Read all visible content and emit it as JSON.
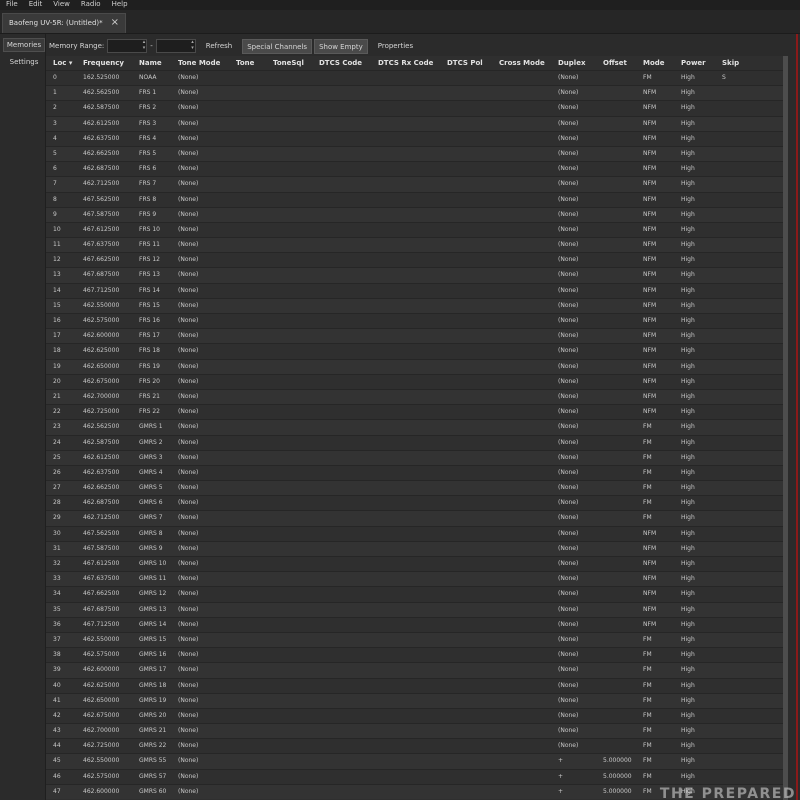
{
  "menu": [
    "File",
    "Edit",
    "View",
    "Radio",
    "Help"
  ],
  "file_tab": {
    "label": "Baofeng UV-5R: (Untitled)*",
    "close": "×"
  },
  "side_tabs": {
    "memories": "Memories",
    "settings": "Settings"
  },
  "toolbar": {
    "memory_range_label": "Memory Range:",
    "range_dash": "-",
    "refresh": "Refresh",
    "special_channels": "Special Channels",
    "show_empty": "Show Empty",
    "properties": "Properties"
  },
  "columns": [
    "Loc ▾",
    "Frequency",
    "Name",
    "Tone Mode",
    "Tone",
    "ToneSql",
    "DTCS Code",
    "DTCS Rx Code",
    "DTCS Pol",
    "Cross Mode",
    "Duplex",
    "Offset",
    "Mode",
    "Power",
    "Skip"
  ],
  "rows": [
    {
      "loc": "0",
      "freq": "162.525000",
      "name": "NOAA",
      "tmode": "(None)",
      "duplex": "(None)",
      "offset": "",
      "mode": "FM",
      "power": "High",
      "skip": "S"
    },
    {
      "loc": "1",
      "freq": "462.562500",
      "name": "FRS 1",
      "tmode": "(None)",
      "duplex": "(None)",
      "offset": "",
      "mode": "NFM",
      "power": "High",
      "skip": ""
    },
    {
      "loc": "2",
      "freq": "462.587500",
      "name": "FRS 2",
      "tmode": "(None)",
      "duplex": "(None)",
      "offset": "",
      "mode": "NFM",
      "power": "High",
      "skip": ""
    },
    {
      "loc": "3",
      "freq": "462.612500",
      "name": "FRS 3",
      "tmode": "(None)",
      "duplex": "(None)",
      "offset": "",
      "mode": "NFM",
      "power": "High",
      "skip": ""
    },
    {
      "loc": "4",
      "freq": "462.637500",
      "name": "FRS 4",
      "tmode": "(None)",
      "duplex": "(None)",
      "offset": "",
      "mode": "NFM",
      "power": "High",
      "skip": ""
    },
    {
      "loc": "5",
      "freq": "462.662500",
      "name": "FRS 5",
      "tmode": "(None)",
      "duplex": "(None)",
      "offset": "",
      "mode": "NFM",
      "power": "High",
      "skip": ""
    },
    {
      "loc": "6",
      "freq": "462.687500",
      "name": "FRS 6",
      "tmode": "(None)",
      "duplex": "(None)",
      "offset": "",
      "mode": "NFM",
      "power": "High",
      "skip": ""
    },
    {
      "loc": "7",
      "freq": "462.712500",
      "name": "FRS 7",
      "tmode": "(None)",
      "duplex": "(None)",
      "offset": "",
      "mode": "NFM",
      "power": "High",
      "skip": ""
    },
    {
      "loc": "8",
      "freq": "467.562500",
      "name": "FRS 8",
      "tmode": "(None)",
      "duplex": "(None)",
      "offset": "",
      "mode": "NFM",
      "power": "High",
      "skip": ""
    },
    {
      "loc": "9",
      "freq": "467.587500",
      "name": "FRS 9",
      "tmode": "(None)",
      "duplex": "(None)",
      "offset": "",
      "mode": "NFM",
      "power": "High",
      "skip": ""
    },
    {
      "loc": "10",
      "freq": "467.612500",
      "name": "FRS 10",
      "tmode": "(None)",
      "duplex": "(None)",
      "offset": "",
      "mode": "NFM",
      "power": "High",
      "skip": ""
    },
    {
      "loc": "11",
      "freq": "467.637500",
      "name": "FRS 11",
      "tmode": "(None)",
      "duplex": "(None)",
      "offset": "",
      "mode": "NFM",
      "power": "High",
      "skip": ""
    },
    {
      "loc": "12",
      "freq": "467.662500",
      "name": "FRS 12",
      "tmode": "(None)",
      "duplex": "(None)",
      "offset": "",
      "mode": "NFM",
      "power": "High",
      "skip": ""
    },
    {
      "loc": "13",
      "freq": "467.687500",
      "name": "FRS 13",
      "tmode": "(None)",
      "duplex": "(None)",
      "offset": "",
      "mode": "NFM",
      "power": "High",
      "skip": ""
    },
    {
      "loc": "14",
      "freq": "467.712500",
      "name": "FRS 14",
      "tmode": "(None)",
      "duplex": "(None)",
      "offset": "",
      "mode": "NFM",
      "power": "High",
      "skip": ""
    },
    {
      "loc": "15",
      "freq": "462.550000",
      "name": "FRS 15",
      "tmode": "(None)",
      "duplex": "(None)",
      "offset": "",
      "mode": "NFM",
      "power": "High",
      "skip": ""
    },
    {
      "loc": "16",
      "freq": "462.575000",
      "name": "FRS 16",
      "tmode": "(None)",
      "duplex": "(None)",
      "offset": "",
      "mode": "NFM",
      "power": "High",
      "skip": ""
    },
    {
      "loc": "17",
      "freq": "462.600000",
      "name": "FRS 17",
      "tmode": "(None)",
      "duplex": "(None)",
      "offset": "",
      "mode": "NFM",
      "power": "High",
      "skip": ""
    },
    {
      "loc": "18",
      "freq": "462.625000",
      "name": "FRS 18",
      "tmode": "(None)",
      "duplex": "(None)",
      "offset": "",
      "mode": "NFM",
      "power": "High",
      "skip": ""
    },
    {
      "loc": "19",
      "freq": "462.650000",
      "name": "FRS 19",
      "tmode": "(None)",
      "duplex": "(None)",
      "offset": "",
      "mode": "NFM",
      "power": "High",
      "skip": ""
    },
    {
      "loc": "20",
      "freq": "462.675000",
      "name": "FRS 20",
      "tmode": "(None)",
      "duplex": "(None)",
      "offset": "",
      "mode": "NFM",
      "power": "High",
      "skip": ""
    },
    {
      "loc": "21",
      "freq": "462.700000",
      "name": "FRS 21",
      "tmode": "(None)",
      "duplex": "(None)",
      "offset": "",
      "mode": "NFM",
      "power": "High",
      "skip": ""
    },
    {
      "loc": "22",
      "freq": "462.725000",
      "name": "FRS 22",
      "tmode": "(None)",
      "duplex": "(None)",
      "offset": "",
      "mode": "NFM",
      "power": "High",
      "skip": ""
    },
    {
      "loc": "23",
      "freq": "462.562500",
      "name": "GMRS 1",
      "tmode": "(None)",
      "duplex": "(None)",
      "offset": "",
      "mode": "FM",
      "power": "High",
      "skip": ""
    },
    {
      "loc": "24",
      "freq": "462.587500",
      "name": "GMRS 2",
      "tmode": "(None)",
      "duplex": "(None)",
      "offset": "",
      "mode": "FM",
      "power": "High",
      "skip": ""
    },
    {
      "loc": "25",
      "freq": "462.612500",
      "name": "GMRS 3",
      "tmode": "(None)",
      "duplex": "(None)",
      "offset": "",
      "mode": "FM",
      "power": "High",
      "skip": ""
    },
    {
      "loc": "26",
      "freq": "462.637500",
      "name": "GMRS 4",
      "tmode": "(None)",
      "duplex": "(None)",
      "offset": "",
      "mode": "FM",
      "power": "High",
      "skip": ""
    },
    {
      "loc": "27",
      "freq": "462.662500",
      "name": "GMRS 5",
      "tmode": "(None)",
      "duplex": "(None)",
      "offset": "",
      "mode": "FM",
      "power": "High",
      "skip": ""
    },
    {
      "loc": "28",
      "freq": "462.687500",
      "name": "GMRS 6",
      "tmode": "(None)",
      "duplex": "(None)",
      "offset": "",
      "mode": "FM",
      "power": "High",
      "skip": ""
    },
    {
      "loc": "29",
      "freq": "462.712500",
      "name": "GMRS 7",
      "tmode": "(None)",
      "duplex": "(None)",
      "offset": "",
      "mode": "FM",
      "power": "High",
      "skip": ""
    },
    {
      "loc": "30",
      "freq": "467.562500",
      "name": "GMRS 8",
      "tmode": "(None)",
      "duplex": "(None)",
      "offset": "",
      "mode": "NFM",
      "power": "High",
      "skip": ""
    },
    {
      "loc": "31",
      "freq": "467.587500",
      "name": "GMRS 9",
      "tmode": "(None)",
      "duplex": "(None)",
      "offset": "",
      "mode": "NFM",
      "power": "High",
      "skip": ""
    },
    {
      "loc": "32",
      "freq": "467.612500",
      "name": "GMRS 10",
      "tmode": "(None)",
      "duplex": "(None)",
      "offset": "",
      "mode": "NFM",
      "power": "High",
      "skip": ""
    },
    {
      "loc": "33",
      "freq": "467.637500",
      "name": "GMRS 11",
      "tmode": "(None)",
      "duplex": "(None)",
      "offset": "",
      "mode": "NFM",
      "power": "High",
      "skip": ""
    },
    {
      "loc": "34",
      "freq": "467.662500",
      "name": "GMRS 12",
      "tmode": "(None)",
      "duplex": "(None)",
      "offset": "",
      "mode": "NFM",
      "power": "High",
      "skip": ""
    },
    {
      "loc": "35",
      "freq": "467.687500",
      "name": "GMRS 13",
      "tmode": "(None)",
      "duplex": "(None)",
      "offset": "",
      "mode": "NFM",
      "power": "High",
      "skip": ""
    },
    {
      "loc": "36",
      "freq": "467.712500",
      "name": "GMRS 14",
      "tmode": "(None)",
      "duplex": "(None)",
      "offset": "",
      "mode": "NFM",
      "power": "High",
      "skip": ""
    },
    {
      "loc": "37",
      "freq": "462.550000",
      "name": "GMRS 15",
      "tmode": "(None)",
      "duplex": "(None)",
      "offset": "",
      "mode": "FM",
      "power": "High",
      "skip": ""
    },
    {
      "loc": "38",
      "freq": "462.575000",
      "name": "GMRS 16",
      "tmode": "(None)",
      "duplex": "(None)",
      "offset": "",
      "mode": "FM",
      "power": "High",
      "skip": ""
    },
    {
      "loc": "39",
      "freq": "462.600000",
      "name": "GMRS 17",
      "tmode": "(None)",
      "duplex": "(None)",
      "offset": "",
      "mode": "FM",
      "power": "High",
      "skip": ""
    },
    {
      "loc": "40",
      "freq": "462.625000",
      "name": "GMRS 18",
      "tmode": "(None)",
      "duplex": "(None)",
      "offset": "",
      "mode": "FM",
      "power": "High",
      "skip": ""
    },
    {
      "loc": "41",
      "freq": "462.650000",
      "name": "GMRS 19",
      "tmode": "(None)",
      "duplex": "(None)",
      "offset": "",
      "mode": "FM",
      "power": "High",
      "skip": ""
    },
    {
      "loc": "42",
      "freq": "462.675000",
      "name": "GMRS 20",
      "tmode": "(None)",
      "duplex": "(None)",
      "offset": "",
      "mode": "FM",
      "power": "High",
      "skip": ""
    },
    {
      "loc": "43",
      "freq": "462.700000",
      "name": "GMRS 21",
      "tmode": "(None)",
      "duplex": "(None)",
      "offset": "",
      "mode": "FM",
      "power": "High",
      "skip": ""
    },
    {
      "loc": "44",
      "freq": "462.725000",
      "name": "GMRS 22",
      "tmode": "(None)",
      "duplex": "(None)",
      "offset": "",
      "mode": "FM",
      "power": "High",
      "skip": ""
    },
    {
      "loc": "45",
      "freq": "462.550000",
      "name": "GMRS 55",
      "tmode": "(None)",
      "duplex": "+",
      "offset": "5.000000",
      "mode": "FM",
      "power": "High",
      "skip": ""
    },
    {
      "loc": "46",
      "freq": "462.575000",
      "name": "GMRS 57",
      "tmode": "(None)",
      "duplex": "+",
      "offset": "5.000000",
      "mode": "FM",
      "power": "High",
      "skip": ""
    },
    {
      "loc": "47",
      "freq": "462.600000",
      "name": "GMRS 60",
      "tmode": "(None)",
      "duplex": "+",
      "offset": "5.000000",
      "mode": "FM",
      "power": "High",
      "skip": ""
    }
  ],
  "watermark": "THE PREPARED",
  "colors": {
    "background": "#2b2b2b",
    "border_accent": "#8a1a1a"
  }
}
